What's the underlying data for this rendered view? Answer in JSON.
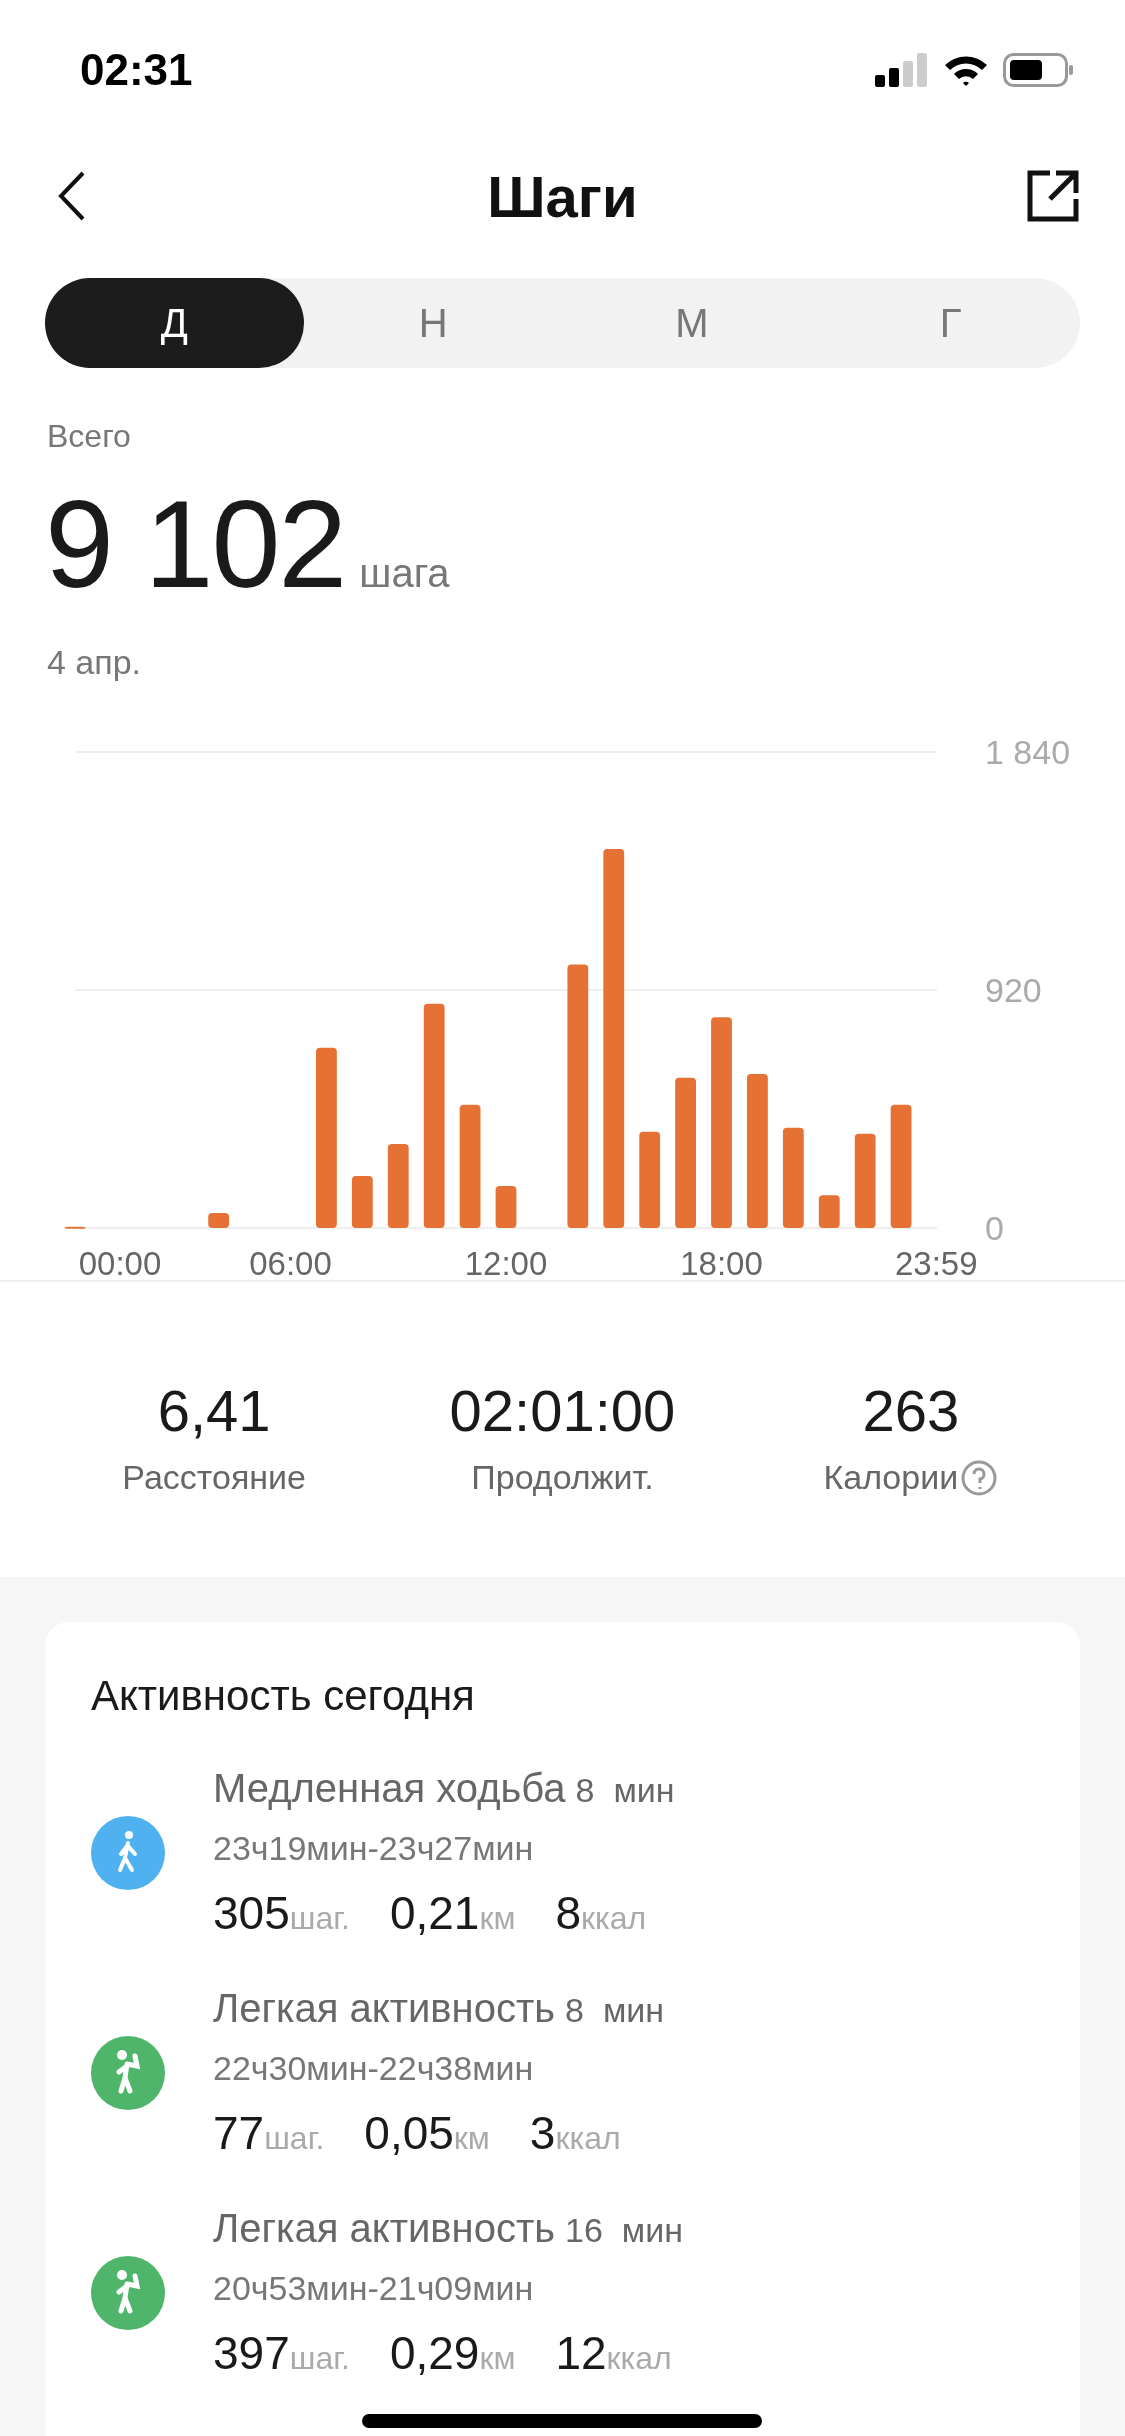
{
  "status_bar": {
    "time": "02:31"
  },
  "nav": {
    "title": "Шаги"
  },
  "tabs": [
    {
      "label": "Д",
      "selected": true
    },
    {
      "label": "Н",
      "selected": false
    },
    {
      "label": "М",
      "selected": false
    },
    {
      "label": "Г",
      "selected": false
    }
  ],
  "summary": {
    "label": "Всего",
    "value": "9 102",
    "unit": "шага",
    "date": "4 апр."
  },
  "chart_data": {
    "type": "bar",
    "x": [
      0,
      4,
      7,
      8,
      9,
      10,
      11,
      12,
      14,
      15,
      16,
      17,
      18,
      19,
      20,
      21,
      22,
      23
    ],
    "xlim": [
      0,
      24
    ],
    "series": [
      {
        "color": "#e57134",
        "values": [
          5,
          58,
          697,
          201,
          325,
          867,
          476,
          162,
          1019,
          1465,
          372,
          581,
          815,
          595,
          388,
          127,
          364,
          476
        ]
      }
    ],
    "ylim": [
      0,
      1840
    ],
    "yticks": [
      0,
      {
        "value": 920,
        "label": "920"
      },
      {
        "value": 1840,
        "label": "1 840"
      }
    ],
    "xticks": [
      {
        "value": 0,
        "label": "00:00"
      },
      {
        "value": 6,
        "label": "06:00"
      },
      {
        "value": 12,
        "label": "12:00"
      },
      {
        "value": 18,
        "label": "18:00"
      },
      {
        "value": 23.98,
        "label": "23:59"
      }
    ]
  },
  "stats": [
    {
      "value": "6,41",
      "label": "Расстояние"
    },
    {
      "value": "02:01:00",
      "label": "Продолжит."
    },
    {
      "value": "263",
      "label": "Калории",
      "help": true
    }
  ],
  "activity": {
    "title": "Активность сегодня",
    "items": [
      {
        "kind": "walk",
        "color": "#4fb1ef",
        "name": "Медленная ходьба",
        "duration": "8",
        "duration_unit": "мин",
        "range": "23ч19мин-23ч27мин",
        "steps": "305",
        "steps_unit": "шаг.",
        "distance": "0,21",
        "distance_unit": "км",
        "calories": "8",
        "calories_unit": "ккал"
      },
      {
        "kind": "light",
        "color": "#4fb56a",
        "name": "Легкая активность",
        "duration": "8",
        "duration_unit": "мин",
        "range": "22ч30мин-22ч38мин",
        "steps": "77",
        "steps_unit": "шаг.",
        "distance": "0,05",
        "distance_unit": "км",
        "calories": "3",
        "calories_unit": "ккал"
      },
      {
        "kind": "light",
        "color": "#4fb56a",
        "name": "Легкая активность",
        "duration": "16",
        "duration_unit": "мин",
        "range": "20ч53мин-21ч09мин",
        "steps": "397",
        "steps_unit": "шаг.",
        "distance": "0,29",
        "distance_unit": "км",
        "calories": "12",
        "calories_unit": "ккал"
      }
    ]
  }
}
